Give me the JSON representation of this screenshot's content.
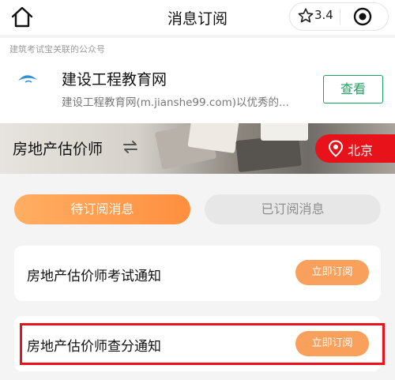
{
  "nav": {
    "title": "消息订阅",
    "rating": "3.4"
  },
  "official_account": {
    "associated_label": "建筑考试宝关联的公众号",
    "name": "建设工程教育网",
    "description": "建设工程教育网(m.jianshe99.com)以优秀的...",
    "view_button": "查看"
  },
  "hero": {
    "exam_name": "房地产估价师",
    "city": "北京"
  },
  "tabs": [
    {
      "label": "待订阅消息",
      "active": true
    },
    {
      "label": "已订阅消息",
      "active": false
    }
  ],
  "messages": [
    {
      "title": "房地产估价师考试通知",
      "button": "立即订阅"
    },
    {
      "title": "房地产估价师查分通知",
      "button": "立即订阅"
    }
  ],
  "colors": {
    "accent_orange": "#ff9a4f",
    "city_red": "#e8131a",
    "view_green": "#20a162"
  }
}
